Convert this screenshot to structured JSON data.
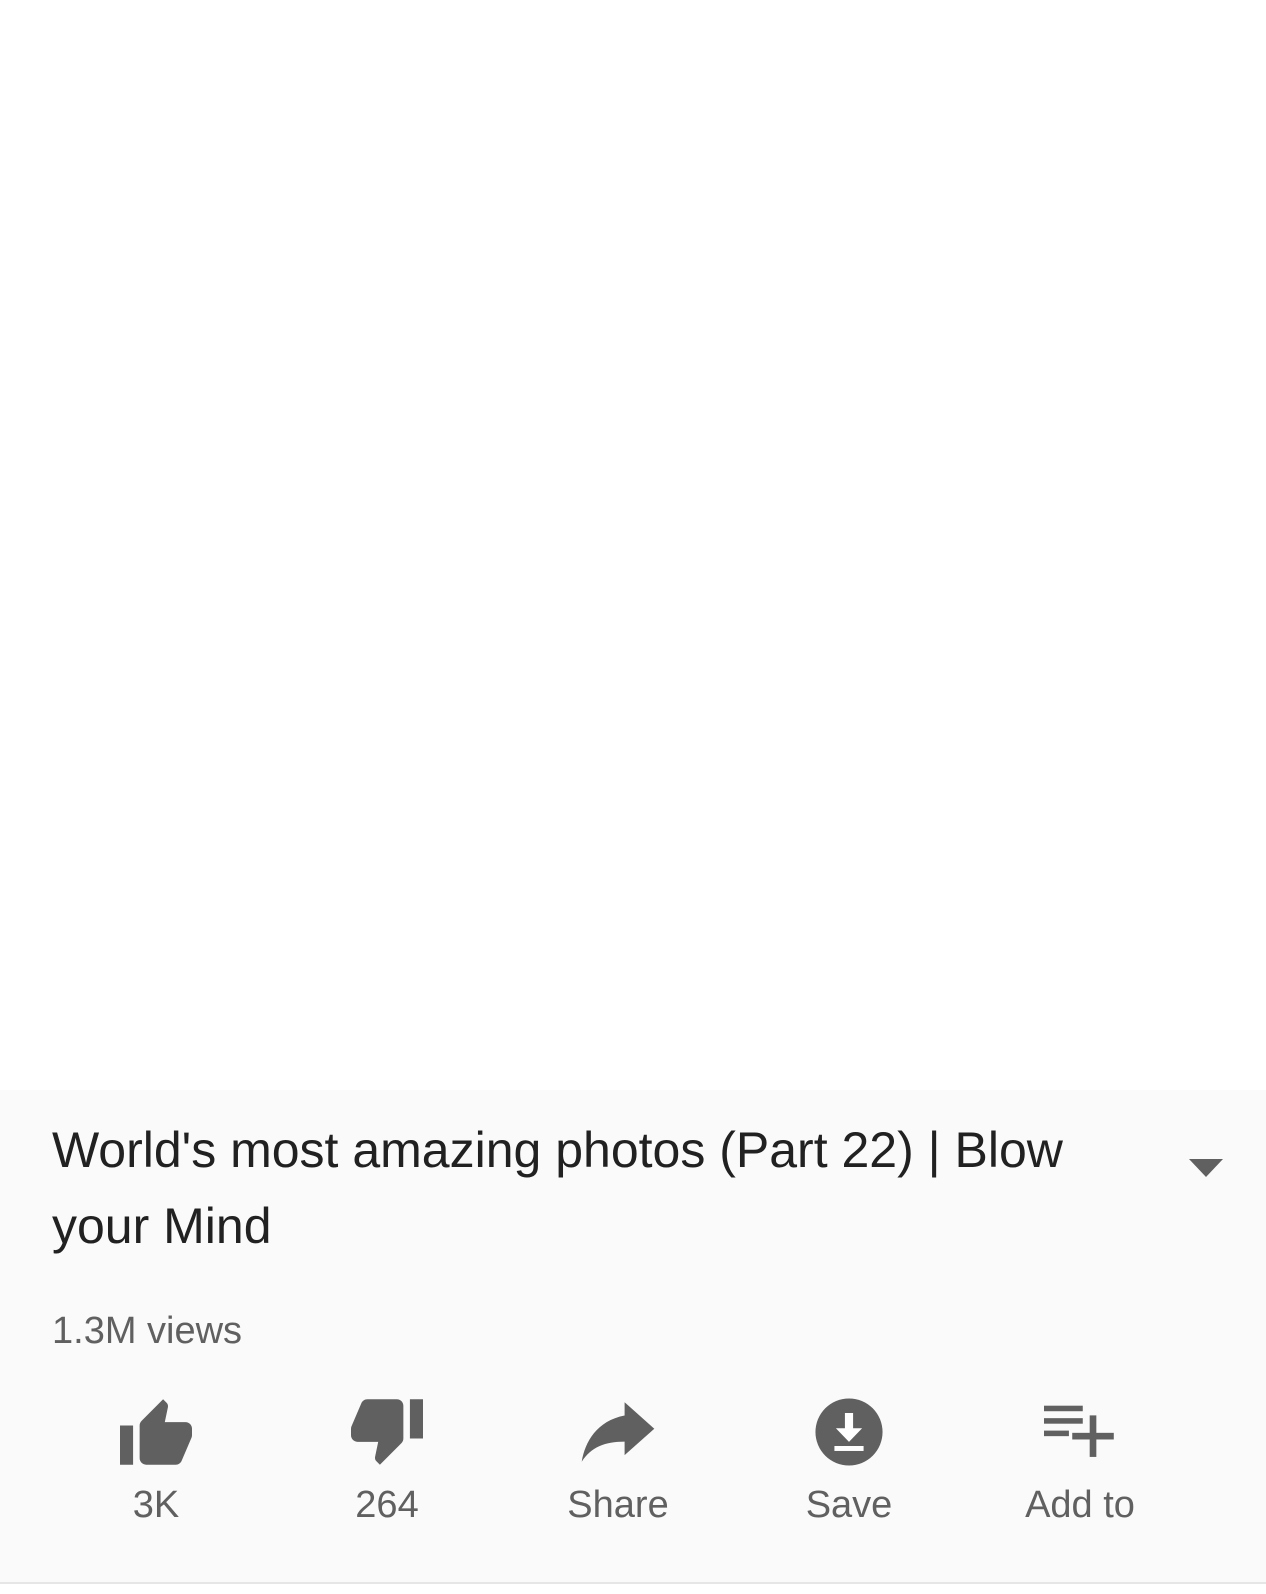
{
  "video": {
    "title": "World's most amazing photos (Part 22) | Blow your Mind",
    "views": "1.3M views"
  },
  "actions": [
    {
      "label": "3K",
      "icon": "thumbs-up-icon"
    },
    {
      "label": "264",
      "icon": "thumbs-down-icon"
    },
    {
      "label": "Share",
      "icon": "share-icon"
    },
    {
      "label": "Save",
      "icon": "download-icon"
    },
    {
      "label": "Add to",
      "icon": "playlist-add-icon"
    }
  ],
  "colors": {
    "title": "#212121",
    "secondary_text": "#606060",
    "icon": "#606060",
    "panel_background": "#fafafa"
  }
}
